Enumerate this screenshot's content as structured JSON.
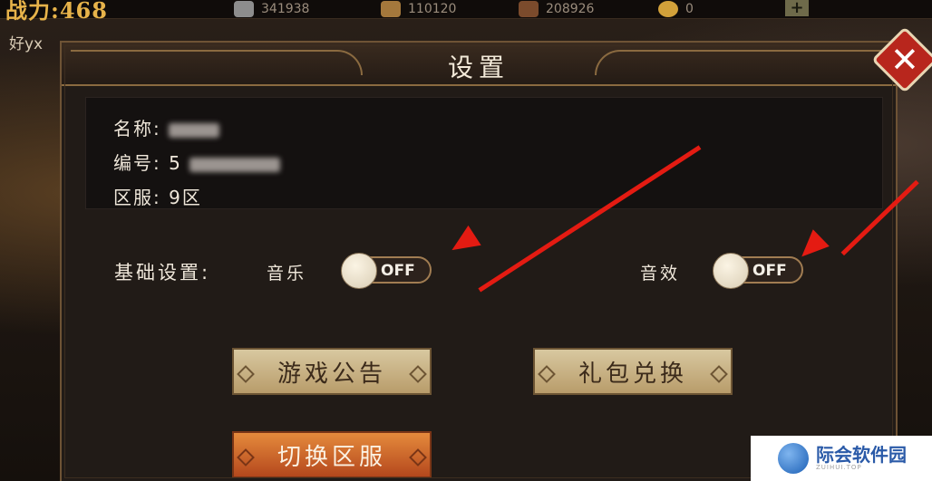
{
  "topbar": {
    "power": "战力:468",
    "silver": "341938",
    "food": "110120",
    "soldiers": "208926",
    "gold": "0",
    "plus": "+"
  },
  "left_name": "好yx",
  "dialog": {
    "title": "设置",
    "close": "✕",
    "info": {
      "name_label": "名称:",
      "id_label": "编号:",
      "id_prefix": "5",
      "server_label": "区服:",
      "server_value": "9区"
    },
    "basic_settings_label": "基础设置:",
    "music_label": "音乐",
    "music_state": "OFF",
    "sfx_label": "音效",
    "sfx_state": "OFF",
    "buttons": {
      "announcement": "游戏公告",
      "gift_redeem": "礼包兑换",
      "switch_server": "切换区服"
    }
  },
  "watermark": {
    "text": "际会软件园",
    "sub": "ZUIHUI.TOP"
  },
  "colors": {
    "accent_red": "#e41b12",
    "gold": "#8a6a40",
    "orange_button": "#d0692e"
  }
}
